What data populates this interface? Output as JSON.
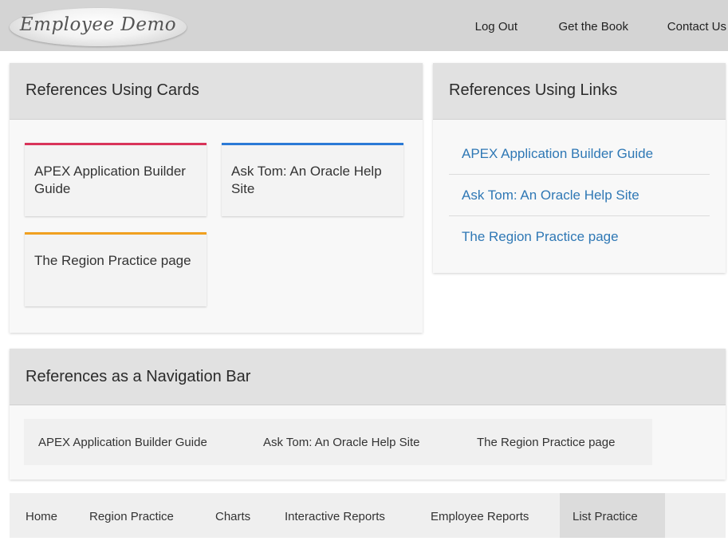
{
  "header": {
    "logo_text": "Employee Demo",
    "links": [
      "Log Out",
      "Get the Book",
      "Contact Us"
    ]
  },
  "cards_region": {
    "title": "References Using Cards",
    "cards": [
      {
        "label": "APEX Application Builder Guide",
        "color": "#d9345a"
      },
      {
        "label": "Ask Tom: An Oracle Help Site",
        "color": "#2b7ad6"
      },
      {
        "label": "The Region Practice page",
        "color": "#f0a020"
      }
    ]
  },
  "links_region": {
    "title": "References Using Links",
    "links": [
      "APEX Application Builder Guide",
      "Ask Tom: An Oracle Help Site",
      "The Region Practice page"
    ]
  },
  "navbar_region": {
    "title": "References as a Navigation Bar",
    "items": [
      "APEX Application Builder Guide",
      "Ask Tom: An Oracle Help Site",
      "The Region Practice page"
    ]
  },
  "tabs": {
    "items": [
      "Home",
      "Region Practice",
      "Charts",
      "Interactive Reports",
      "Employee Reports",
      "List Practice"
    ],
    "active": "List Practice"
  },
  "colors": {
    "link": "#2f78b5",
    "header_bg": "#d4d4d4",
    "region_header_bg": "#e1e1e1"
  }
}
